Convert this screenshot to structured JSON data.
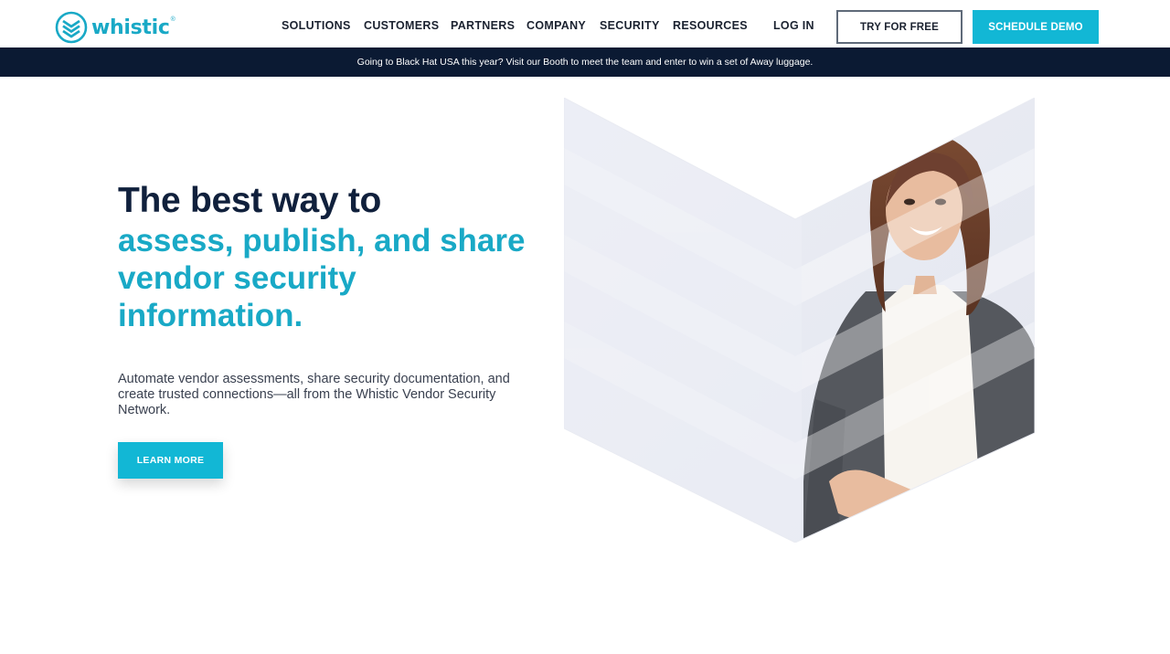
{
  "header": {
    "logo_text": "whistic",
    "logo_mark": "®",
    "nav": [
      "SOLUTIONS",
      "CUSTOMERS",
      "PARTNERS",
      "COMPANY",
      "SECURITY",
      "RESOURCES"
    ],
    "login": "LOG IN",
    "try_free": "TRY FOR FREE",
    "schedule_demo": "SCHEDULE DEMO"
  },
  "banner": {
    "text": "Going to Black Hat USA this year? Visit our Booth to meet the team and enter to win a set of Away luggage."
  },
  "hero": {
    "title_dark": "The best way to",
    "title_accent": "assess, publish, and share vendor security information.",
    "subtitle": "Automate vendor assessments, share security documentation, and create trusted connections—all from the Whistic Vendor Security Network.",
    "cta": "LEARN MORE",
    "image": "woman-professional-photo"
  },
  "colors": {
    "accent": "#12b7d5",
    "navy": "#0b1a33",
    "text_dark": "#10203c"
  }
}
